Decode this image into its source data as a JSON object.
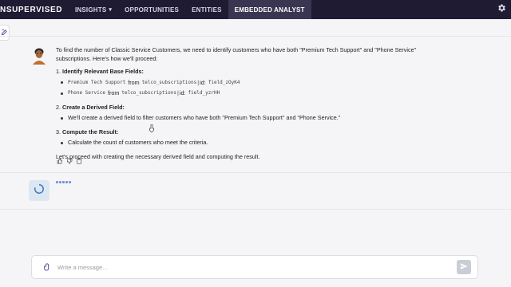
{
  "header": {
    "brand": "NSUPERVISED",
    "nav": [
      {
        "label": "INSIGHTS",
        "has_dropdown": true,
        "active": false
      },
      {
        "label": "OPPORTUNITIES",
        "has_dropdown": false,
        "active": false
      },
      {
        "label": "ENTITIES",
        "has_dropdown": false,
        "active": false
      },
      {
        "label": "EMBEDDED ANALYST",
        "has_dropdown": false,
        "active": true
      }
    ],
    "settings_icon": "gear-icon"
  },
  "sidebar": {
    "new_chat_icon": "edit-icon"
  },
  "conversation": {
    "assistant_message": {
      "intro": "To find the number of Classic Service Customers, we need to identify customers who have both \"Premium Tech Support\" and \"Phone Service\" subscriptions. Here's how we'll proceed:",
      "steps": [
        {
          "number": "1.",
          "title": "Identify Relevant Base Fields",
          "colon": ":",
          "items": [
            {
              "field": "Premium Tech Support",
              "from_word": "from",
              "table": "telco_subscriptions",
              "sep": "|",
              "id_label": "id:",
              "id": "field_zOyK4"
            },
            {
              "field": "Phone Service",
              "from_word": "from",
              "table": "telco_subscriptions",
              "sep": "|",
              "id_label": "id:",
              "id": "field_yzrHH"
            }
          ]
        },
        {
          "number": "2.",
          "title": "Create a Derived Field",
          "colon": ":",
          "text": "We'll create a derived field to filter customers who have both \"Premium Tech Support\" and \"Phone Service.\""
        },
        {
          "number": "3.",
          "title": "Compute the Result",
          "colon": ":",
          "text": "Calculate the count of customers who meet the criteria."
        }
      ],
      "closing": "Let's proceed with creating the necessary derived field and computing the result.",
      "feedback_icons": [
        "thumbs-up-icon",
        "thumbs-down-icon",
        "copy-icon"
      ]
    },
    "loading_icon": "spinner-icon"
  },
  "composer": {
    "placeholder": "Write a message...",
    "value": "",
    "attach_icon": "paperclip-icon",
    "send_icon": "send-icon"
  }
}
